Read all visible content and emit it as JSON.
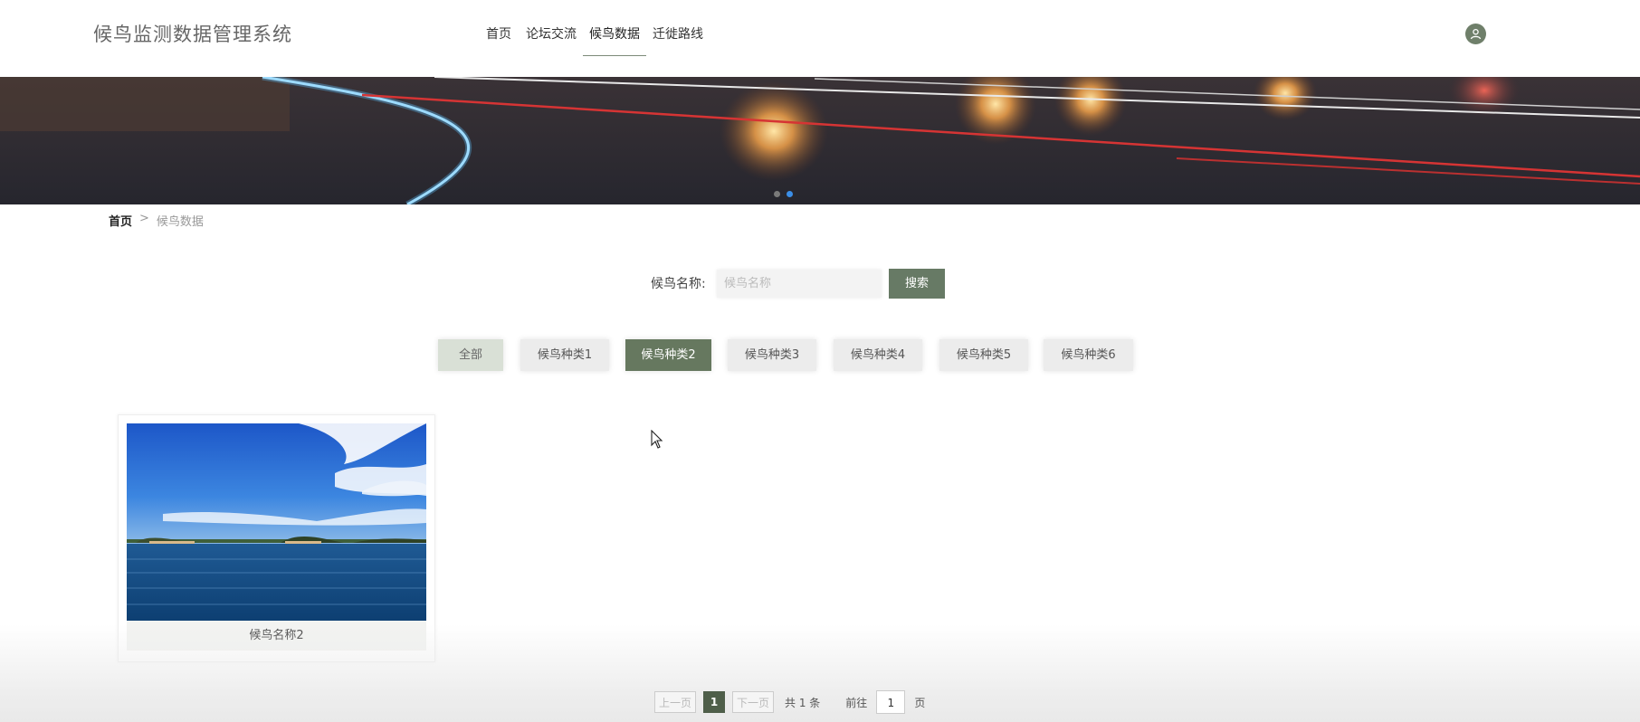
{
  "header": {
    "brand": "候鸟监测数据管理系统",
    "nav": [
      {
        "label": "首页"
      },
      {
        "label": "论坛交流"
      },
      {
        "label": "候鸟数据"
      },
      {
        "label": "迁徙路线"
      }
    ],
    "active_nav": "候鸟数据",
    "avatar_icon": "user-icon"
  },
  "breadcrumb": {
    "home": "首页",
    "separator": ">",
    "current": "候鸟数据"
  },
  "search": {
    "label": "候鸟名称:",
    "placeholder": "候鸟名称",
    "button": "搜索"
  },
  "categories": [
    {
      "label": "全部"
    },
    {
      "label": "候鸟种类1"
    },
    {
      "label": "候鸟种类2"
    },
    {
      "label": "候鸟种类3"
    },
    {
      "label": "候鸟种类4"
    },
    {
      "label": "候鸟种类5"
    },
    {
      "label": "候鸟种类6"
    }
  ],
  "active_category": "候鸟种类2",
  "cards": [
    {
      "title": "候鸟名称2"
    }
  ],
  "pagination": {
    "prev": "上一页",
    "current_page": "1",
    "next": "下一页",
    "total": "共 1 条",
    "goto_label": "前往",
    "goto_value": "1",
    "page_suffix": "页"
  },
  "colors": {
    "accent": "#677a65",
    "accent_dark": "#4f5f4a",
    "carousel_active_dot": "#3b8ee8"
  }
}
